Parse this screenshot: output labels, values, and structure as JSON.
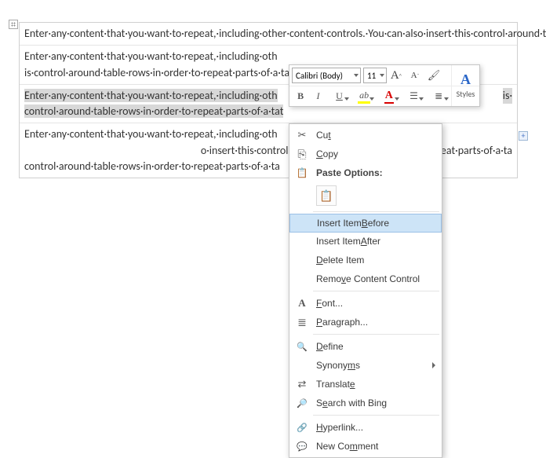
{
  "doc": {
    "para1": "Enter·any·content·that·you·want·to·repeat,·including·other·content·controls.·You·can·also·insert·this·control·around·table·rows·in·order·to·repeat·parts·of·a·table.¶",
    "para2a": "Enter·any·content·that·you·want·to·repeat,·including·oth",
    "para2b": "is·control·around·table·rows·in·order·to·repeat·parts·of·a·ta",
    "selected_a": "Enter·any·content·that·you·want·to·repeat,·including·oth",
    "selected_tail": "is·",
    "selected_b": "control·around·table·rows·in·order·to·repeat·parts·of·a·tat",
    "para4a": "Enter·any·content·that·you·want·to·repeat,·including·oth",
    "para4b": "o·insert·this·control·around·table·rows·in·order·to·repeat·parts·of·a·ta"
  },
  "toolbar": {
    "font_name": "Calibri (Body)",
    "font_size": "11",
    "bold": "B",
    "italic": "I",
    "underline": "U",
    "bigA": "A",
    "smA": "A",
    "highlightA": "ab",
    "fontColorA": "A",
    "styles_label": "Styles",
    "styles_glyph": "A"
  },
  "ctx": {
    "cut": "Cut",
    "copy": "Copy",
    "paste_options": "Paste Options:",
    "insert_before_a": "Insert Item ",
    "insert_before_b": "B",
    "insert_before_c": "efore",
    "insert_after_a": "Insert Item ",
    "insert_after_b": "A",
    "insert_after_c": "fter",
    "delete_a": "D",
    "delete_b": "elete Item",
    "remove": "Remove Content Control",
    "font_a": "F",
    "font_b": "ont...",
    "para_a": "P",
    "para_b": "aragraph...",
    "define_a": "D",
    "define_b": "efine",
    "syn_a": "Synony",
    "syn_b": "m",
    "syn_c": "s",
    "trans_a": "Translat",
    "trans_b": "e",
    "bing_a": "S",
    "bing_b": "e",
    "bing_c": "arch with Bing",
    "link_a": "H",
    "link_b": "yperlink...",
    "comment_a": "New Co",
    "comment_b": "m",
    "comment_c": "ment"
  }
}
